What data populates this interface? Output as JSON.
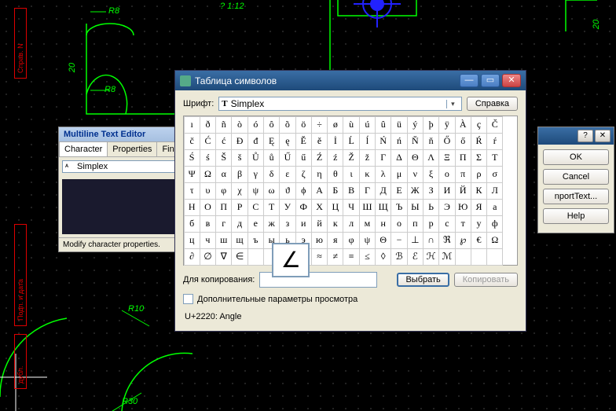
{
  "cad": {
    "dim_r8_1": "R8",
    "dim_r8_2": "R8",
    "dim_20_1": "20",
    "dim_20_2": "20",
    "dim_slope": "?  1:12",
    "dim_r10": "R10",
    "dim_r30": "R30",
    "side_tab_1": "Справ. N",
    "side_tab_2": "Подп. и дата",
    "side_tab_3": "дубл."
  },
  "mte": {
    "title": "Multiline Text Editor",
    "tabs": [
      "Character",
      "Properties",
      "Find"
    ],
    "font": "Simplex",
    "status": "Modify character properties."
  },
  "rpanel": {
    "ok": "OK",
    "cancel": "Cancel",
    "import": "nportText...",
    "help": "Help"
  },
  "cmap": {
    "title": "Таблица символов",
    "font_label": "Шрифт:",
    "font": "Simplex",
    "help": "Справка",
    "copy_label": "Для копирования:",
    "copy_value": "",
    "select": "Выбрать",
    "copy": "Копировать",
    "advanced": "Дополнительные параметры просмотра",
    "status": "U+2220: Angle",
    "selected_char": "∠",
    "rows": [
      [
        "ı",
        "ð",
        "ñ",
        "ò",
        "ó",
        "ô",
        "õ",
        "ö",
        "÷",
        "ø",
        "ù",
        "ú",
        "û",
        "ü",
        "ý",
        "þ",
        "ÿ",
        "À",
        "ç",
        "Č"
      ],
      [
        "č",
        "Ć",
        "ć",
        "Đ",
        "đ",
        "Ę",
        "ę",
        "Ě",
        "ě",
        "İ",
        "Ĺ",
        "ĺ",
        "Ń",
        "ń",
        "Ň",
        "ň",
        "Ő",
        "ő",
        "Ŕ",
        "ŕ"
      ],
      [
        "Ś",
        "ś",
        "Š",
        "š",
        "Ů",
        "ů",
        "Ű",
        "ű",
        "Ź",
        "ź",
        "Ž",
        "ž",
        "Γ",
        "Δ",
        "Θ",
        "Λ",
        "Ξ",
        "Π",
        "Σ",
        "Τ"
      ],
      [
        "Ψ",
        "Ω",
        "α",
        "β",
        "γ",
        "δ",
        "ε",
        "ζ",
        "η",
        "θ",
        "ι",
        "κ",
        "λ",
        "μ",
        "ν",
        "ξ",
        "ο",
        "π",
        "ρ",
        "σ"
      ],
      [
        "τ",
        "υ",
        "φ",
        "χ",
        "ψ",
        "ω",
        "ϑ",
        "ϕ",
        "А",
        "Б",
        "В",
        "Г",
        "Д",
        "Е",
        "Ж",
        "З",
        "И",
        "Й",
        "К",
        "Л"
      ],
      [
        "Н",
        "О",
        "П",
        "Р",
        "С",
        "Т",
        "У",
        "Ф",
        "Х",
        "Ц",
        "Ч",
        "Ш",
        "Щ",
        "Ъ",
        "Ы",
        "Ь",
        "Э",
        "Ю",
        "Я",
        "а"
      ],
      [
        "б",
        "в",
        "г",
        "д",
        "е",
        "ж",
        "з",
        "и",
        "й",
        "к",
        "л",
        "м",
        "н",
        "о",
        "п",
        "р",
        "с",
        "т",
        "у",
        "ф"
      ],
      [
        "ц",
        "ч",
        "ш",
        "щ",
        "ъ",
        "ы",
        "ь",
        "э",
        "ю",
        "я",
        "φ",
        "ψ",
        "Θ",
        "−",
        "⊥",
        "∩",
        "ℜ",
        "℘",
        "€",
        "Ω"
      ],
      [
        "∂",
        "∅",
        "∇",
        "∈",
        "",
        "",
        "∠",
        "",
        "≈",
        "≠",
        "≡",
        "≤",
        "◊",
        "ℬ",
        "ℰ",
        "ℋ",
        "ℳ",
        "",
        "",
        ""
      ]
    ],
    "sel": [
      8,
      6
    ]
  }
}
